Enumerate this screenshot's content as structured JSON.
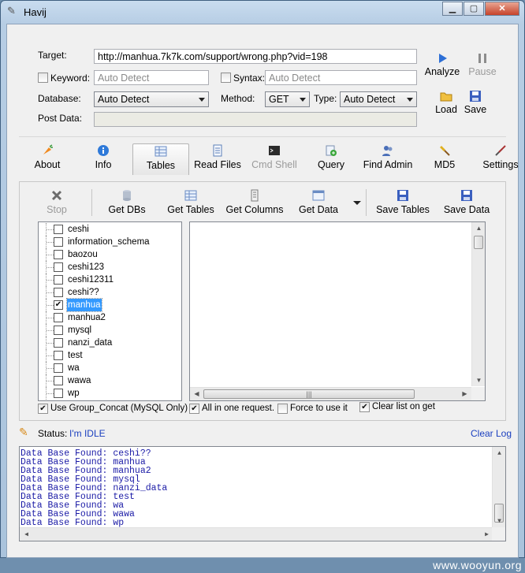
{
  "window": {
    "title": "Havij"
  },
  "form": {
    "target_label": "Target:",
    "target_value": "http://manhua.7k7k.com/support/wrong.php?vid=198",
    "keyword_label": "Keyword:",
    "keyword_placeholder": "Auto Detect",
    "syntax_label": "Syntax:",
    "syntax_placeholder": "Auto Detect",
    "database_label": "Database:",
    "database_value": "Auto Detect",
    "method_label": "Method:",
    "method_value": "GET",
    "type_label": "Type:",
    "type_value": "Auto Detect",
    "post_label": "Post Data:"
  },
  "side_buttons": {
    "analyze": "Analyze",
    "pause": "Pause",
    "load": "Load",
    "save": "Save"
  },
  "tabs": [
    "About",
    "Info",
    "Tables",
    "Read Files",
    "Cmd Shell",
    "Query",
    "Find Admin",
    "MD5",
    "Settings"
  ],
  "actions": [
    "Stop",
    "Get DBs",
    "Get Tables",
    "Get Columns",
    "Get Data",
    "Save Tables",
    "Save Data"
  ],
  "databases": [
    {
      "name": "ceshi",
      "checked": false
    },
    {
      "name": "information_schema",
      "checked": false
    },
    {
      "name": "baozou",
      "checked": false
    },
    {
      "name": "ceshi123",
      "checked": false
    },
    {
      "name": "ceshi12311",
      "checked": false
    },
    {
      "name": "ceshi??",
      "checked": false
    },
    {
      "name": "manhua",
      "checked": true
    },
    {
      "name": "manhua2",
      "checked": false
    },
    {
      "name": "mysql",
      "checked": false
    },
    {
      "name": "nanzi_data",
      "checked": false
    },
    {
      "name": "test",
      "checked": false
    },
    {
      "name": "wa",
      "checked": false
    },
    {
      "name": "wawa",
      "checked": false
    },
    {
      "name": "wp",
      "checked": false
    }
  ],
  "options": {
    "group_concat": "Use Group_Concat (MySQL Only)",
    "all_in_one": "All in one request.",
    "force": "Force to use it",
    "clear_list": "Clear list on get"
  },
  "status": {
    "label": "Status:",
    "value": "I'm IDLE",
    "clear_log": "Clear Log"
  },
  "log": [
    "Data Base Found: ceshi??",
    "Data Base Found: manhua",
    "Data Base Found: manhua2",
    "Data Base Found: mysql",
    "Data Base Found: nanzi_data",
    "Data Base Found: test",
    "Data Base Found: wa",
    "Data Base Found: wawa",
    "Data Base Found: wp"
  ],
  "watermark": "www.wooyun.org"
}
